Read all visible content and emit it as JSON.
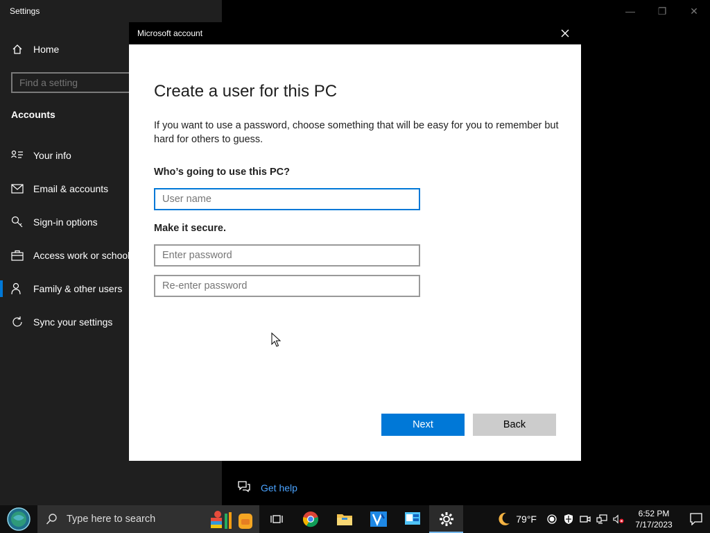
{
  "settings": {
    "window_title": "Settings",
    "home_label": "Home",
    "search_placeholder": "Find a setting",
    "section_title": "Accounts",
    "nav_items": [
      {
        "label": "Your info",
        "icon": "person-card-icon"
      },
      {
        "label": "Email & accounts",
        "icon": "mail-icon"
      },
      {
        "label": "Sign-in options",
        "icon": "key-icon"
      },
      {
        "label": "Access work or school",
        "icon": "briefcase-icon"
      },
      {
        "label": "Family & other users",
        "icon": "person-add-icon",
        "active": true
      },
      {
        "label": "Sync your settings",
        "icon": "sync-icon"
      }
    ],
    "get_help_label": "Get help"
  },
  "dialog": {
    "title": "Microsoft account",
    "heading": "Create a user for this PC",
    "description": "If you want to use a password, choose something that will be easy for you to remember but hard for others to guess.",
    "who_label": "Who’s going to use this PC?",
    "username_placeholder": "User name",
    "secure_label": "Make it secure.",
    "password_placeholder": "Enter password",
    "reenter_placeholder": "Re-enter password",
    "next_label": "Next",
    "back_label": "Back"
  },
  "taskbar": {
    "search_placeholder": "Type here to search",
    "weather_temp": "79°F",
    "time": "6:52 PM",
    "date": "7/17/2023"
  },
  "colors": {
    "accent": "#0078d7",
    "sidebar_bg": "#1f1f1f",
    "link": "#4aa3ff"
  }
}
